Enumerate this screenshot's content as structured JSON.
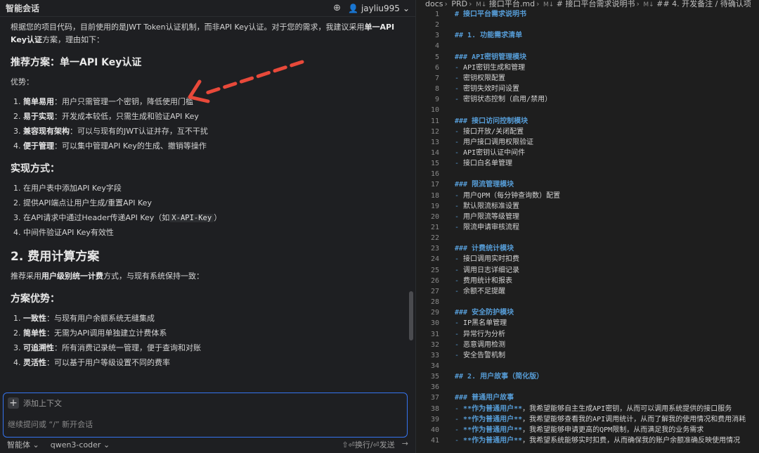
{
  "chat": {
    "title": "智能会话",
    "username": "jayliu995",
    "intro_1": "根据您的项目代码，目前使用的是JWT Token认证机制，而非API Key认证。对于您的需求，我建议采用",
    "intro_bold": "单一API Key认证",
    "intro_2": "方案，理由如下：",
    "h_recommend": "推荐方案：单一API Key认证",
    "advantages_label": "优势：",
    "advantages": [
      {
        "num": "1.",
        "bold": "简单易用",
        "text": "：用户只需管理一个密钥，降低使用门槛"
      },
      {
        "num": "2.",
        "bold": "易于实现",
        "text": "：开发成本较低，只需生成和验证API Key"
      },
      {
        "num": "3.",
        "bold": "兼容现有架构",
        "text": "：可以与现有的JWT认证并存，互不干扰"
      },
      {
        "num": "4.",
        "bold": "便于管理",
        "text": "：可以集中管理API Key的生成、撤销等操作"
      }
    ],
    "h_impl": "实现方式：",
    "impl": [
      {
        "num": "1.",
        "text": "在用户表中添加API Key字段"
      },
      {
        "num": "2.",
        "text": "提供API端点让用户生成/重置API Key"
      },
      {
        "num": "3.",
        "text": "在API请求中通过Header传递API Key（如",
        "code": "X-API-Key",
        "tail": "）"
      },
      {
        "num": "4.",
        "text": "中间件验证API Key有效性"
      }
    ],
    "h_cost": "2. 费用计算方案",
    "cost_1": "推荐采用",
    "cost_bold": "用户级别统一计费",
    "cost_2": "方式，与现有系统保持一致：",
    "h_cost_adv": "方案优势：",
    "cost_adv": [
      {
        "num": "1.",
        "bold": "一致性",
        "text": "：与现有用户余额系统无缝集成"
      },
      {
        "num": "2.",
        "bold": "简单性",
        "text": "：无需为API调用单独建立计费体系"
      },
      {
        "num": "3.",
        "bold": "可追溯性",
        "text": "：所有消费记录统一管理，便于查询和对账"
      },
      {
        "num": "4.",
        "bold": "灵活性",
        "text": "：可以基于用户等级设置不同的费率"
      }
    ],
    "add_context": "添加上下文",
    "input_placeholder": "继续提问或 “/” 新开会话",
    "mode": "智能体",
    "model": "qwen3-coder",
    "hint_newline": "⇧⏎换行/⏎发送"
  },
  "editor": {
    "breadcrumb": [
      "docs",
      "PRD",
      "接口平台.md",
      "# 接口平台需求说明书",
      "## 4. 开发备注 / 待确认项"
    ],
    "lines": [
      {
        "n": 1,
        "k": "h",
        "t": "# 接口平台需求说明书"
      },
      {
        "n": 2,
        "k": "e",
        "t": ""
      },
      {
        "n": 3,
        "k": "h",
        "t": "## 1. 功能需求清单"
      },
      {
        "n": 4,
        "k": "e",
        "t": ""
      },
      {
        "n": 5,
        "k": "h",
        "t": "### API密钥管理模块"
      },
      {
        "n": 6,
        "k": "l",
        "t": "API密钥生成和管理"
      },
      {
        "n": 7,
        "k": "l",
        "t": "密钥权限配置"
      },
      {
        "n": 8,
        "k": "l",
        "t": "密钥失效时间设置"
      },
      {
        "n": 9,
        "k": "l",
        "t": "密钥状态控制（启用/禁用）"
      },
      {
        "n": 10,
        "k": "e",
        "t": ""
      },
      {
        "n": 11,
        "k": "h",
        "t": "### 接口访问控制模块"
      },
      {
        "n": 12,
        "k": "l",
        "t": "接口开放/关闭配置"
      },
      {
        "n": 13,
        "k": "l",
        "t": "用户接口调用权限验证"
      },
      {
        "n": 14,
        "k": "l",
        "t": "API密钥认证中间件"
      },
      {
        "n": 15,
        "k": "l",
        "t": "接口白名单管理"
      },
      {
        "n": 16,
        "k": "e",
        "t": ""
      },
      {
        "n": 17,
        "k": "h",
        "t": "### 限流管理模块"
      },
      {
        "n": 18,
        "k": "l",
        "t": "用户QPM（每分钟查询数）配置"
      },
      {
        "n": 19,
        "k": "l",
        "t": "默认限流标准设置"
      },
      {
        "n": 20,
        "k": "l",
        "t": "用户限流等级管理"
      },
      {
        "n": 21,
        "k": "l",
        "t": "限流申请审核流程"
      },
      {
        "n": 22,
        "k": "e",
        "t": ""
      },
      {
        "n": 23,
        "k": "h",
        "t": "### 计费统计模块"
      },
      {
        "n": 24,
        "k": "l",
        "t": "接口调用实时扣费"
      },
      {
        "n": 25,
        "k": "l",
        "t": "调用日志详细记录"
      },
      {
        "n": 26,
        "k": "l",
        "t": "费用统计和报表"
      },
      {
        "n": 27,
        "k": "l",
        "t": "余额不足提醒"
      },
      {
        "n": 28,
        "k": "e",
        "t": ""
      },
      {
        "n": 29,
        "k": "h",
        "t": "### 安全防护模块"
      },
      {
        "n": 30,
        "k": "l",
        "t": "IP黑名单管理"
      },
      {
        "n": 31,
        "k": "l",
        "t": "异常行为分析"
      },
      {
        "n": 32,
        "k": "l",
        "t": "恶意调用检测"
      },
      {
        "n": 33,
        "k": "l",
        "t": "安全告警机制"
      },
      {
        "n": 34,
        "k": "e",
        "t": ""
      },
      {
        "n": 35,
        "k": "h",
        "t": "## 2. 用户故事（简化版）"
      },
      {
        "n": 36,
        "k": "e",
        "t": ""
      },
      {
        "n": 37,
        "k": "h",
        "t": "### 普通用户故事"
      },
      {
        "n": 38,
        "k": "s",
        "b": "**作为普通用户**",
        "t": "，我希望能够自主生成API密钥，从而可以调用系统提供的接口服务"
      },
      {
        "n": 39,
        "k": "s",
        "b": "**作为普通用户**",
        "t": "，我希望能够查看我的API调用统计，从而了解我的使用情况和费用消耗"
      },
      {
        "n": 40,
        "k": "s",
        "b": "**作为普通用户**",
        "t": "，我希望能够申请更高的QPM限制，从而满足我的业务需求"
      },
      {
        "n": 41,
        "k": "s",
        "b": "**作为普通用户**",
        "t": "，我希望系统能够实时扣费，从而确保我的账户余额准确反映使用情况"
      }
    ]
  },
  "colors": {
    "accent": "#3574f0",
    "arrow": "#e8493a",
    "md_keyword": "#569cd6"
  }
}
